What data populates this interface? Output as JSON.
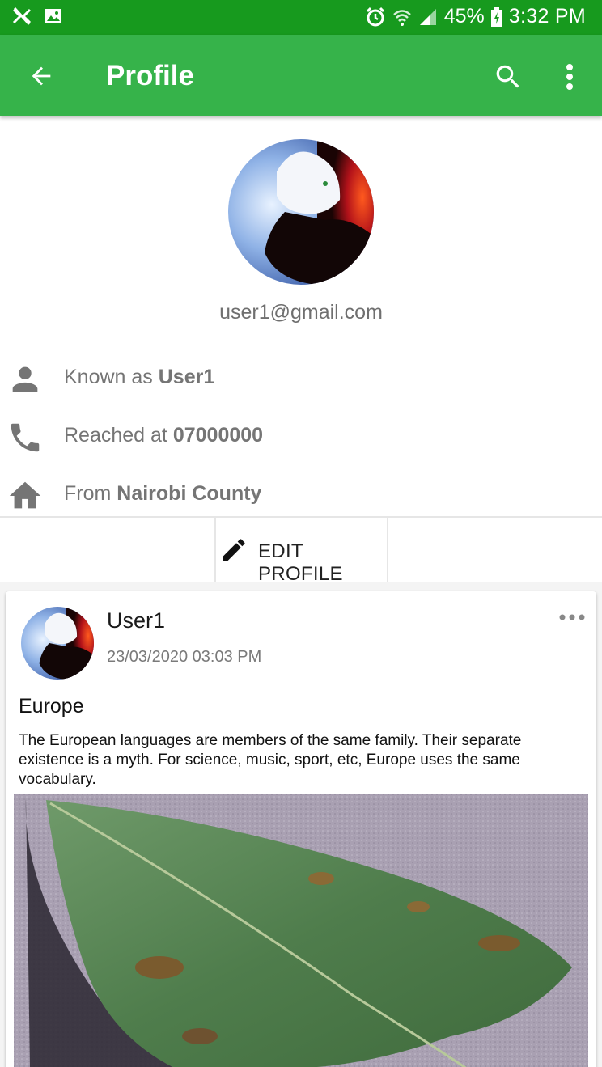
{
  "status_bar": {
    "battery": "45%",
    "time": "3:32 PM",
    "icons": [
      "signal-off-icon",
      "image-icon",
      "alarm-icon",
      "wifi-icon",
      "cell-signal-icon",
      "battery-charging-icon"
    ]
  },
  "app_bar": {
    "title": "Profile",
    "icons": [
      "arrow-back-icon",
      "search-icon",
      "more-vert-icon"
    ],
    "color": "#36b34a"
  },
  "profile": {
    "email": "user1@gmail.com",
    "known_as_prefix": "Known as",
    "known_as_value": "User1",
    "reached_prefix": "Reached at",
    "reached_value": "07000000",
    "from_prefix": "From",
    "from_value": "Nairobi County",
    "icons": [
      "person-icon",
      "phone-icon",
      "home-icon"
    ]
  },
  "edit_button": {
    "label": "EDIT PROFILE",
    "icon": "pencil-icon"
  },
  "post": {
    "author": "User1",
    "date": "23/03/2020 03:03 PM",
    "title": "Europe",
    "body": "The European languages are members of the same family. Their separate existence is a myth. For science, music, sport, etc, Europe uses the same vocabulary.",
    "more_icon": "more-horiz-icon"
  }
}
